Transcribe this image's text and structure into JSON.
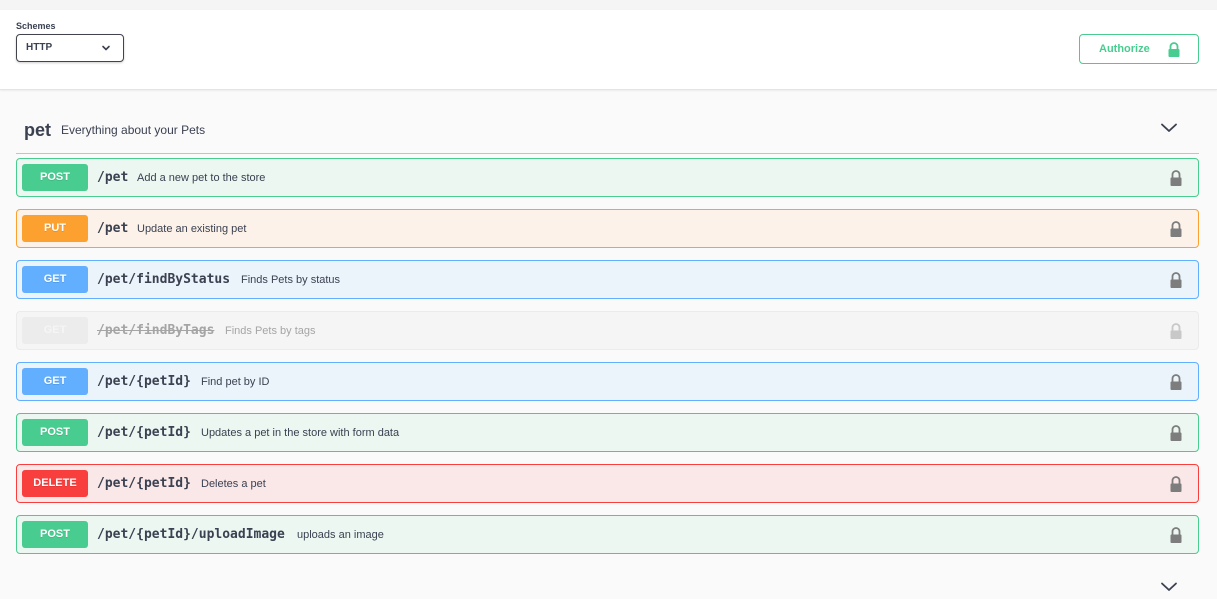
{
  "schemes": {
    "label": "Schemes",
    "selected": "HTTP"
  },
  "authorize": {
    "label": "Authorize",
    "color": "#49cc90"
  },
  "tag": {
    "name": "pet",
    "description": "Everything about your Pets"
  },
  "operations": [
    {
      "method": "POST",
      "path": "/pet",
      "summary": "Add a new pet to the store",
      "style": "post"
    },
    {
      "method": "PUT",
      "path": "/pet",
      "summary": "Update an existing pet",
      "style": "put"
    },
    {
      "method": "GET",
      "path": "/pet/findByStatus",
      "summary": "Finds Pets by status",
      "style": "get"
    },
    {
      "method": "GET",
      "path": "/pet/findByTags",
      "summary": "Finds Pets by tags",
      "style": "deprecated"
    },
    {
      "method": "GET",
      "path": "/pet/{petId}",
      "summary": "Find pet by ID",
      "style": "get"
    },
    {
      "method": "POST",
      "path": "/pet/{petId}",
      "summary": "Updates a pet in the store with form data",
      "style": "post"
    },
    {
      "method": "DELETE",
      "path": "/pet/{petId}",
      "summary": "Deletes a pet",
      "style": "delete"
    },
    {
      "method": "POST",
      "path": "/pet/{petId}/uploadImage",
      "summary": "uploads an image",
      "style": "post"
    }
  ],
  "colors": {
    "post": "#49cc90",
    "put": "#fca130",
    "get": "#61affe",
    "delete": "#f93e3e"
  },
  "icons": {
    "lock": "lock-icon",
    "chevron": "chevron-down-icon"
  }
}
